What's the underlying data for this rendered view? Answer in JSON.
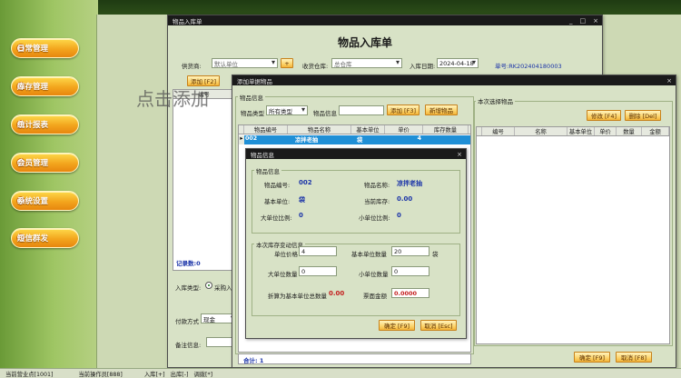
{
  "sidebar": {
    "items": [
      {
        "label": "日常管理"
      },
      {
        "label": "库存管理"
      },
      {
        "label": "统计报表"
      },
      {
        "label": "会员管理"
      },
      {
        "label": "系统设置"
      },
      {
        "label": "短信群发"
      }
    ]
  },
  "watermark_text": "点击添加",
  "status": {
    "store": "当前营业点[1001]",
    "operator": "当前操作员[888]",
    "in": "入库[+]",
    "out": "出库[-]",
    "adjust": "调拨[*]"
  },
  "stock_in_window": {
    "title": "物品入库单",
    "heading": "物品入库单",
    "supplier_label": "供货商:",
    "supplier_value": "默认单位",
    "warehouse_label": "收货仓库:",
    "warehouse_value": "总仓库",
    "date_label": "入库日期:",
    "date_value": "2024-04-18",
    "order_no": "单号:RK202404180003",
    "add_button": "添加 [F2]",
    "grid_first_col": "编号",
    "record_count": "记录数:0",
    "type_label": "入库类型:",
    "type_option": "采购入",
    "payment_label": "付款方式",
    "payment_value": "现金",
    "remark_label": "备注信息:"
  },
  "add_item_window": {
    "title": "添加单据物品",
    "item_info_title": "物品信息",
    "category_label": "物品类型",
    "category_value": "所有类型",
    "iteminfo_label": "物品信息",
    "add_button": "添加 [F3]",
    "new_item_button": "新增物品",
    "columns": [
      "物品编号",
      "物品名称",
      "基本单位",
      "单价",
      "库存数量"
    ],
    "row": {
      "code": "002",
      "name": "凉拌老抽",
      "unit": "袋",
      "price": "",
      "stock": "4"
    },
    "selected_title": "本次选择物品",
    "edit_button": "修改 [F4]",
    "delete_button": "删除 [Del]",
    "selected_columns": [
      "编号",
      "名称",
      "基本单位",
      "单价",
      "数量",
      "金额"
    ],
    "total": "合计: 1",
    "ok_button": "确定 [F9]",
    "cancel_button": "取消 [F8]"
  },
  "item_dialog": {
    "title": "物品信息",
    "info_title": "物品信息",
    "code_label": "物品编号:",
    "code_value": "002",
    "name_label": "物品名称:",
    "name_value": "凉拌老抽",
    "unit_label": "基本单位:",
    "unit_value": "袋",
    "stock_label": "当前库存:",
    "stock_value": "0.00",
    "big_ratio_label": "大单位比例:",
    "big_ratio_value": "0",
    "small_ratio_label": "小单位比例:",
    "small_ratio_value": "0",
    "change_title": "本次库存变动信息",
    "price_label": "单位价格",
    "price_value": "4",
    "base_qty_label": "基本单位数量",
    "base_qty_value": "20",
    "base_unit_suffix": "袋",
    "big_qty_label": "大单位数量",
    "big_qty_value": "0",
    "small_qty_label": "小单位数量",
    "small_qty_value": "0",
    "total_base_label": "折算为基本单位总数量",
    "total_base_value": "0.00",
    "amount_label": "票面金额",
    "amount_value": "0.0000",
    "ok_button": "确定 [F9]",
    "cancel_button": "取消 [Esc]"
  }
}
